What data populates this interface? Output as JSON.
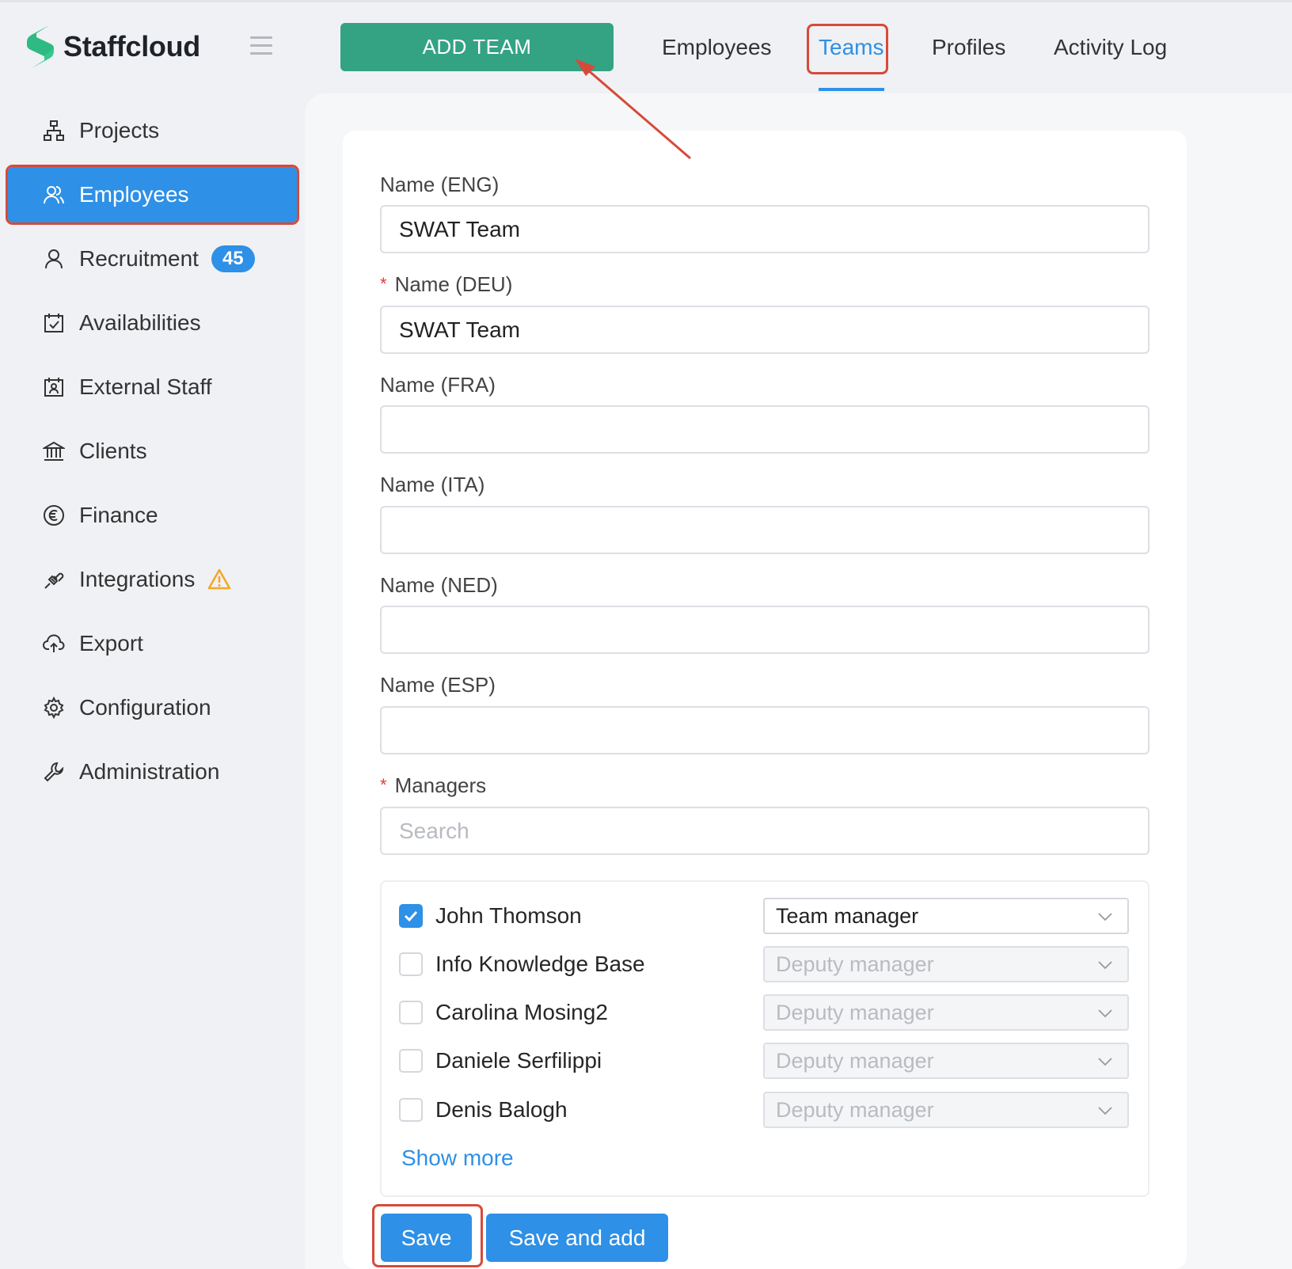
{
  "app": {
    "name": "Staffcloud"
  },
  "colors": {
    "primary": "#2e90e6",
    "accent_green": "#33a384",
    "highlight": "#d64a3a"
  },
  "sidebar": {
    "items": [
      {
        "label": "Projects",
        "icon": "sitemap-icon"
      },
      {
        "label": "Employees",
        "icon": "employees-icon",
        "active": true
      },
      {
        "label": "Recruitment",
        "icon": "user-icon",
        "badge": "45"
      },
      {
        "label": "Availabilities",
        "icon": "calendar-check-icon"
      },
      {
        "label": "External Staff",
        "icon": "calendar-user-icon"
      },
      {
        "label": "Clients",
        "icon": "bank-icon"
      },
      {
        "label": "Finance",
        "icon": "euro-icon"
      },
      {
        "label": "Integrations",
        "icon": "plug-icon",
        "warning": true
      },
      {
        "label": "Export",
        "icon": "cloud-upload-icon"
      },
      {
        "label": "Configuration",
        "icon": "gear-icon"
      },
      {
        "label": "Administration",
        "icon": "wrench-icon"
      }
    ]
  },
  "topbar": {
    "add_button": "ADD TEAM",
    "tabs": [
      {
        "label": "Employees"
      },
      {
        "label": "Teams",
        "active": true
      },
      {
        "label": "Profiles"
      },
      {
        "label": "Activity Log"
      }
    ]
  },
  "form": {
    "fields": [
      {
        "label": "Name (ENG)",
        "value": "SWAT Team",
        "required": false
      },
      {
        "label": "Name (DEU)",
        "value": "SWAT Team",
        "required": true
      },
      {
        "label": "Name (FRA)",
        "value": "",
        "required": false
      },
      {
        "label": "Name (ITA)",
        "value": "",
        "required": false
      },
      {
        "label": "Name (NED)",
        "value": "",
        "required": false
      },
      {
        "label": "Name (ESP)",
        "value": "",
        "required": false
      }
    ],
    "required_mark": "*",
    "managers": {
      "label": "Managers",
      "search_placeholder": "Search",
      "list": [
        {
          "name": "John Thomson",
          "checked": true,
          "role": "Team manager"
        },
        {
          "name": "Info Knowledge Base",
          "checked": false,
          "role": "Deputy manager"
        },
        {
          "name": "Carolina Mosing2",
          "checked": false,
          "role": "Deputy manager"
        },
        {
          "name": "Daniele Serfilippi",
          "checked": false,
          "role": "Deputy manager"
        },
        {
          "name": "Denis Balogh",
          "checked": false,
          "role": "Deputy manager"
        }
      ],
      "show_more": "Show more"
    },
    "buttons": {
      "save": "Save",
      "save_and_add": "Save and add"
    }
  }
}
